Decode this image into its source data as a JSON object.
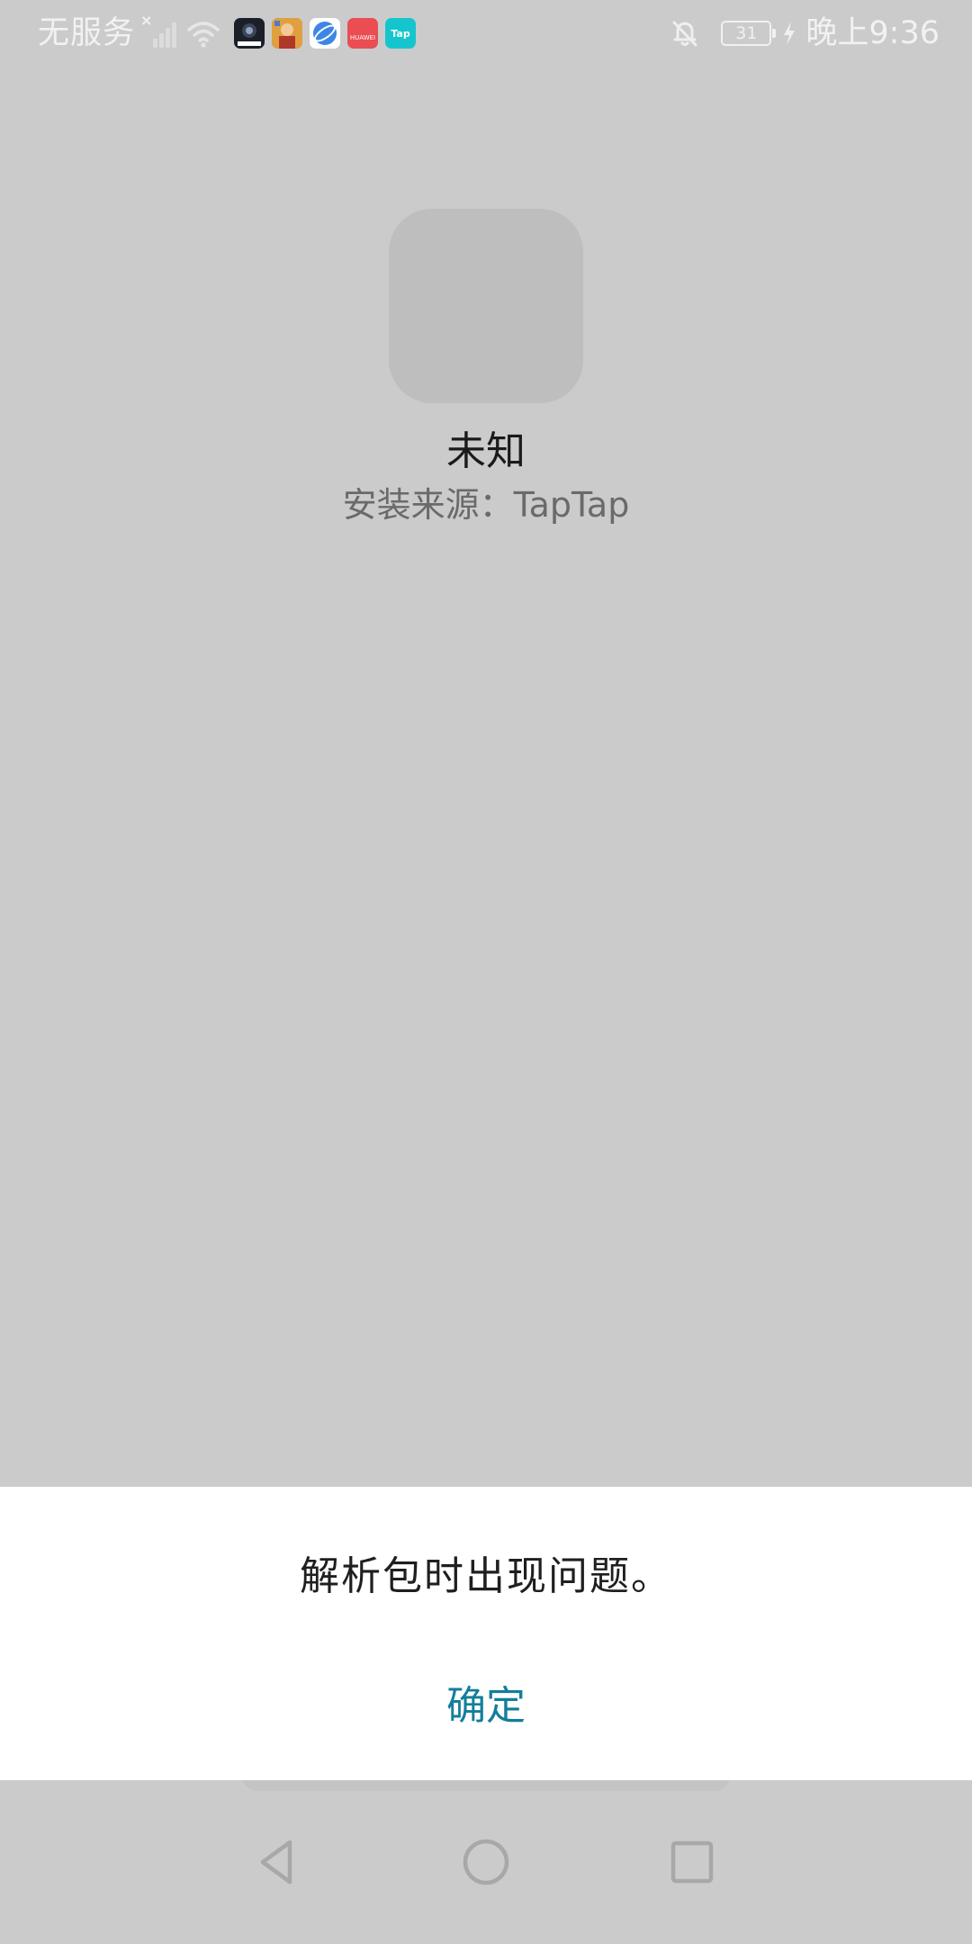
{
  "status_bar": {
    "carrier": "无服务",
    "signal_icon": "no-signal-icon",
    "wifi_icon": "wifi-icon",
    "notification_icons": [
      {
        "name": "dark-app-notification-icon",
        "label": "",
        "color": "#1a1f28"
      },
      {
        "name": "game-app-notification-icon",
        "label": "",
        "color": "#c4582a"
      },
      {
        "name": "browser-notification-icon",
        "label": "",
        "color": "#3d86e6"
      },
      {
        "name": "huawei-notification-icon",
        "label": "HUAWEI",
        "color": "#ea4d52"
      },
      {
        "name": "taptap-notification-icon",
        "label": "Tap",
        "color": "#15c5ce"
      }
    ],
    "mute_icon": "bell-off-icon",
    "battery_level": "31",
    "charging_icon": "charging-bolt-icon",
    "time": "晚上9:36"
  },
  "app": {
    "icon": "placeholder-app-icon",
    "name": "未知",
    "install_source": "安装来源：TapTap"
  },
  "dialog": {
    "message": "解析包时出现问题。",
    "confirm_label": "确定",
    "confirm_color": "#137e9a"
  },
  "navigation": {
    "back_icon": "triangle-back-icon",
    "home_icon": "circle-home-icon",
    "recent_icon": "square-recent-icon"
  }
}
